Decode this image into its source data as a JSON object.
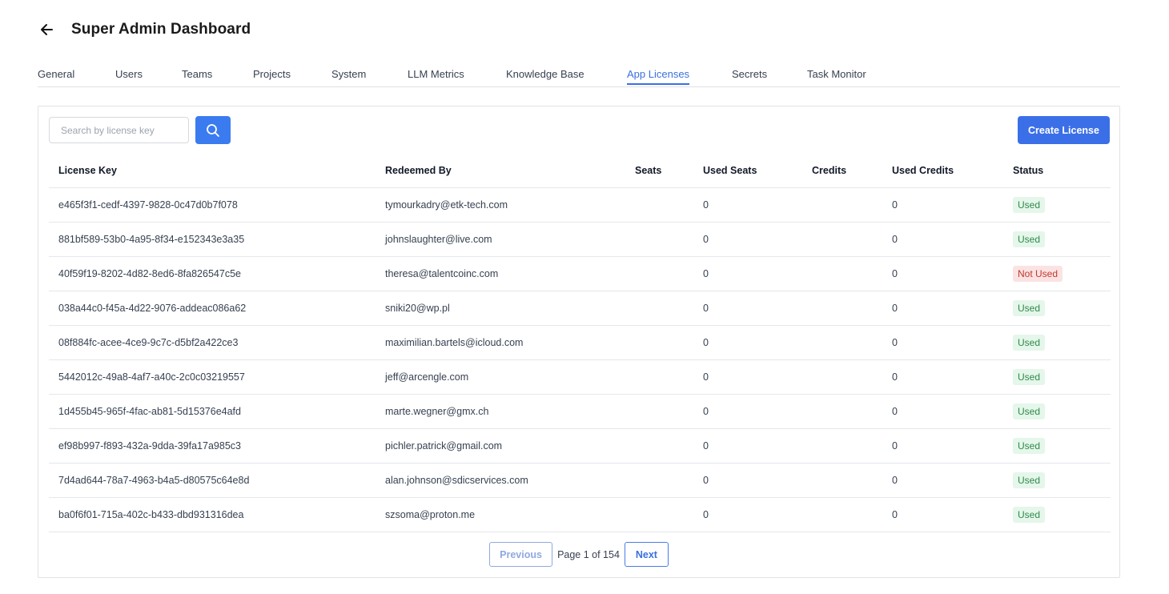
{
  "header": {
    "title": "Super Admin Dashboard",
    "back_icon": "arrow-left-icon"
  },
  "tabs": [
    {
      "label": "General",
      "active": false
    },
    {
      "label": "Users",
      "active": false
    },
    {
      "label": "Teams",
      "active": false
    },
    {
      "label": "Projects",
      "active": false
    },
    {
      "label": "System",
      "active": false
    },
    {
      "label": "LLM Metrics",
      "active": false
    },
    {
      "label": "Knowledge Base",
      "active": false
    },
    {
      "label": "App Licenses",
      "active": true
    },
    {
      "label": "Secrets",
      "active": false
    },
    {
      "label": "Task Monitor",
      "active": false
    }
  ],
  "toolbar": {
    "search_placeholder": "Search by license key",
    "search_value": "",
    "search_icon": "search-icon",
    "create_label": "Create License"
  },
  "table": {
    "columns": [
      "License Key",
      "Redeemed By",
      "Seats",
      "Used Seats",
      "Credits",
      "Used Credits",
      "Status"
    ],
    "rows": [
      {
        "key": "e465f3f1-cedf-4397-9828-0c47d0b7f078",
        "redeemed_by": "tymourkadry@etk-tech.com",
        "seats": "",
        "used_seats": "0",
        "credits": "",
        "used_credits": "0",
        "status": "Used"
      },
      {
        "key": "881bf589-53b0-4a95-8f34-e152343e3a35",
        "redeemed_by": "johnslaughter@live.com",
        "seats": "",
        "used_seats": "0",
        "credits": "",
        "used_credits": "0",
        "status": "Used"
      },
      {
        "key": "40f59f19-8202-4d82-8ed6-8fa826547c5e",
        "redeemed_by": "theresa@talentcoinc.com",
        "seats": "",
        "used_seats": "0",
        "credits": "",
        "used_credits": "0",
        "status": "Not Used"
      },
      {
        "key": "038a44c0-f45a-4d22-9076-addeac086a62",
        "redeemed_by": "sniki20@wp.pl",
        "seats": "",
        "used_seats": "0",
        "credits": "",
        "used_credits": "0",
        "status": "Used"
      },
      {
        "key": "08f884fc-acee-4ce9-9c7c-d5bf2a422ce3",
        "redeemed_by": "maximilian.bartels@icloud.com",
        "seats": "",
        "used_seats": "0",
        "credits": "",
        "used_credits": "0",
        "status": "Used"
      },
      {
        "key": "5442012c-49a8-4af7-a40c-2c0c03219557",
        "redeemed_by": "jeff@arcengle.com",
        "seats": "",
        "used_seats": "0",
        "credits": "",
        "used_credits": "0",
        "status": "Used"
      },
      {
        "key": "1d455b45-965f-4fac-ab81-5d15376e4afd",
        "redeemed_by": "marte.wegner@gmx.ch",
        "seats": "",
        "used_seats": "0",
        "credits": "",
        "used_credits": "0",
        "status": "Used"
      },
      {
        "key": "ef98b997-f893-432a-9dda-39fa17a985c3",
        "redeemed_by": "pichler.patrick@gmail.com",
        "seats": "",
        "used_seats": "0",
        "credits": "",
        "used_credits": "0",
        "status": "Used"
      },
      {
        "key": "7d4ad644-78a7-4963-b4a5-d80575c64e8d",
        "redeemed_by": "alan.johnson@sdicservices.com",
        "seats": "",
        "used_seats": "0",
        "credits": "",
        "used_credits": "0",
        "status": "Used"
      },
      {
        "key": "ba0f6f01-715a-402c-b433-dbd931316dea",
        "redeemed_by": "szsoma@proton.me",
        "seats": "",
        "used_seats": "0",
        "credits": "",
        "used_credits": "0",
        "status": "Used"
      }
    ]
  },
  "pagination": {
    "previous_label": "Previous",
    "info": "Page 1 of 154",
    "next_label": "Next"
  },
  "colors": {
    "accent": "#3b6fe8",
    "used_badge_bg": "#e5f6ea",
    "used_badge_text": "#2f8a4a",
    "not_used_badge_bg": "#fbe3e3",
    "not_used_badge_text": "#c0392b"
  }
}
